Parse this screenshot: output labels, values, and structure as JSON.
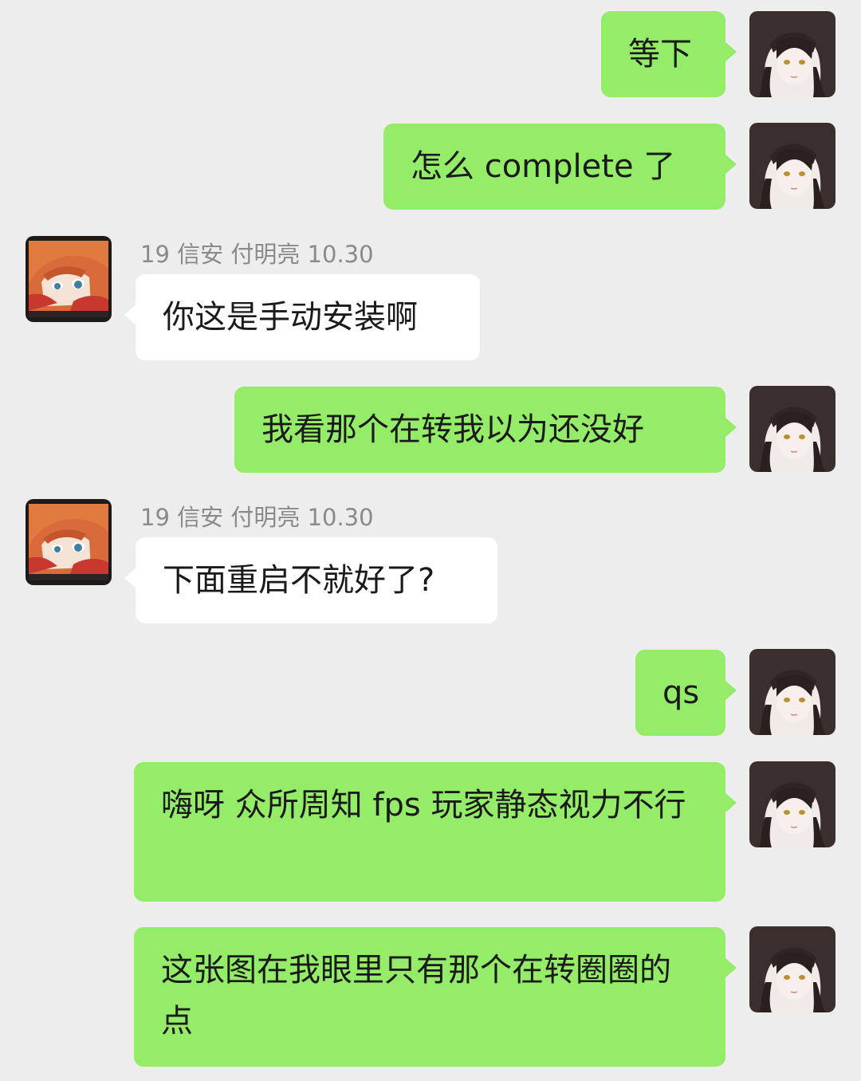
{
  "conversation": {
    "messages": [
      {
        "side": "me",
        "text": "等下"
      },
      {
        "side": "me",
        "text": "怎么 complete 了"
      },
      {
        "side": "them",
        "sender": "19 信安 付明亮 10.30",
        "text": "你这是手动安装啊"
      },
      {
        "side": "me",
        "text": "我看那个在转我以为还没好"
      },
      {
        "side": "them",
        "sender": "19 信安 付明亮 10.30",
        "text": "下面重启不就好了?"
      },
      {
        "side": "me",
        "text": "qs"
      },
      {
        "side": "me",
        "text": "嗨呀 众所周知 fps 玩家静态视力不行"
      },
      {
        "side": "me",
        "text": "这张图在我眼里只有那个在转圈圈的点"
      }
    ]
  },
  "colors": {
    "background": "#ededed",
    "my_bubble": "#95ec69",
    "their_bubble": "#ffffff",
    "sender_text": "#8a8a8a"
  },
  "icons": {
    "self_avatar": "anime-girl-dark-hair-avatar",
    "other_avatar": "anime-boy-orange-hair-avatar"
  }
}
